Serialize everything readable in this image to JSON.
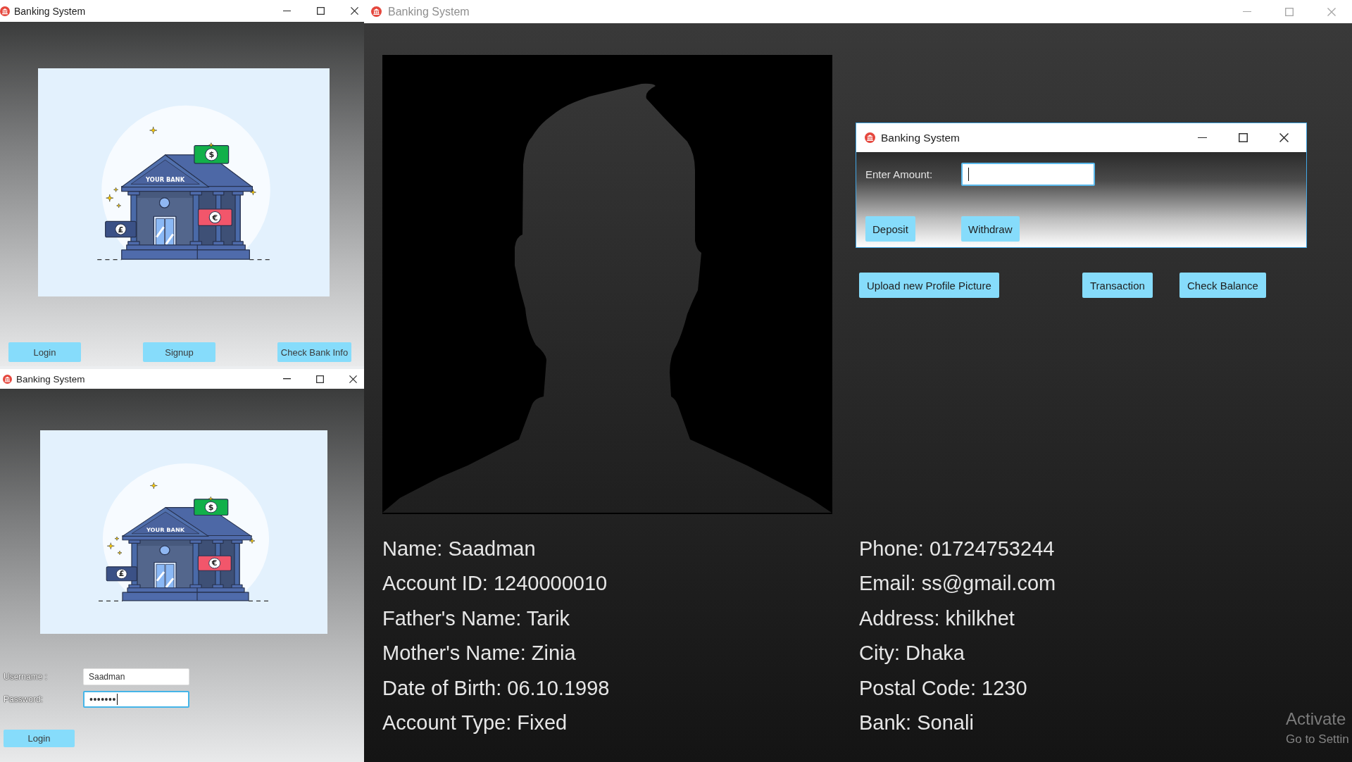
{
  "login_window": {
    "title": "Banking System",
    "active": true,
    "illustration": {
      "sign": "YOUR BANK",
      "notes": [
        {
          "symbol": "$",
          "color": "#12b04a"
        },
        {
          "symbol": "€",
          "color": "#f2566b"
        },
        {
          "symbol": "£",
          "color": "#3b5186"
        }
      ]
    },
    "buttons": [
      "Login",
      "Signup",
      "Check Bank Info"
    ]
  },
  "signin_window": {
    "title": "Banking System",
    "active": true,
    "illustration": {
      "sign": "YOUR BANK",
      "notes": [
        {
          "symbol": "$",
          "color": "#12b04a"
        },
        {
          "symbol": "€",
          "color": "#f2566b"
        },
        {
          "symbol": "£",
          "color": "#3b5186"
        }
      ]
    },
    "fields": [
      {
        "label": "Username :",
        "value": "Saadman",
        "focused": false
      },
      {
        "label": "Password:",
        "value": "•••••••",
        "focused": true
      }
    ],
    "button": "Login"
  },
  "main_window": {
    "title": "Banking System",
    "active": false,
    "buttons": [
      "Upload new Profile Picture",
      "Transaction",
      "Check Balance"
    ],
    "details_left": [
      "Name: Saadman",
      "Account ID: 1240000010",
      "Father's Name: Tarik",
      "Mother's Name: Zinia",
      "Date of Birth: 06.10.1998",
      "Account Type: Fixed"
    ],
    "details_right": [
      "Phone: 01724753244",
      "Email: ss@gmail.com",
      "Address: khilkhet",
      "City: Dhaka",
      "Postal Code: 1230",
      "Bank: Sonali"
    ]
  },
  "amount_dialog": {
    "title": "Banking System",
    "active": true,
    "amount_field": {
      "label": "Enter Amount:",
      "focused": true
    },
    "buttons": [
      "Deposit",
      "Withdraw"
    ]
  },
  "activation_notice": {
    "heading": "Activate",
    "hint": "Go to Settin"
  }
}
